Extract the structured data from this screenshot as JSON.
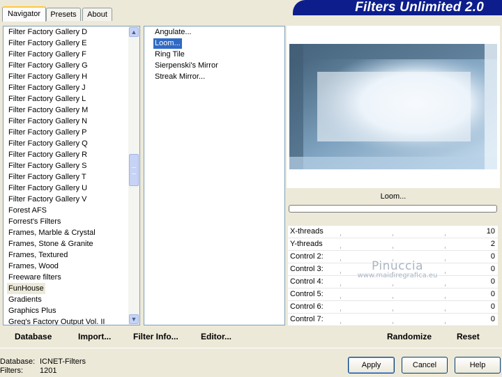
{
  "header": {
    "title": "Filters Unlimited 2.0"
  },
  "tabs": [
    {
      "label": "Navigator",
      "active": true
    },
    {
      "label": "Presets",
      "active": false
    },
    {
      "label": "About",
      "active": false
    }
  ],
  "categories": [
    "Filter Factory Gallery D",
    "Filter Factory Gallery E",
    "Filter Factory Gallery F",
    "Filter Factory Gallery G",
    "Filter Factory Gallery H",
    "Filter Factory Gallery J",
    "Filter Factory Gallery L",
    "Filter Factory Gallery M",
    "Filter Factory Gallery N",
    "Filter Factory Gallery P",
    "Filter Factory Gallery Q",
    "Filter Factory Gallery R",
    "Filter Factory Gallery S",
    "Filter Factory Gallery T",
    "Filter Factory Gallery U",
    "Filter Factory Gallery V",
    "Forest AFS",
    "Forrest's Filters",
    "Frames, Marble & Crystal",
    "Frames, Stone & Granite",
    "Frames, Textured",
    "Frames, Wood",
    "Freeware filters",
    "FunHouse",
    "Gradients",
    "Graphics Plus",
    "Greg's Factory Output Vol. II"
  ],
  "selected_category": "FunHouse",
  "filters": [
    "Angulate...",
    "Loom...",
    "Ring Tile",
    "Sierpenski's Mirror",
    "Streak Mirror..."
  ],
  "selected_filter": "Loom...",
  "preview": {
    "filter_name": "Loom...",
    "progress": 0
  },
  "controls": [
    {
      "label": "X-threads",
      "value": "10"
    },
    {
      "label": "Y-threads",
      "value": "2"
    },
    {
      "label": "Control 2:",
      "value": "0"
    },
    {
      "label": "Control 3:",
      "value": "0"
    },
    {
      "label": "Control 4:",
      "value": "0"
    },
    {
      "label": "Control 5:",
      "value": "0"
    },
    {
      "label": "Control 6:",
      "value": "0"
    },
    {
      "label": "Control 7:",
      "value": "0"
    }
  ],
  "watermark": {
    "name": "Pinuccia",
    "url": "www.maidiregrafica.eu"
  },
  "toolbar": {
    "database": "Database",
    "import": "Import...",
    "filter_info": "Filter Info...",
    "editor": "Editor...",
    "randomize": "Randomize",
    "reset": "Reset"
  },
  "status": {
    "database_label": "Database:",
    "database_value": "ICNET-Filters",
    "filters_label": "Filters:",
    "filters_value": "1201"
  },
  "buttons": {
    "apply": "Apply",
    "cancel": "Cancel",
    "help": "Help"
  },
  "colors": {
    "banner": "#0d1e8c",
    "selection": "#316ac5"
  }
}
